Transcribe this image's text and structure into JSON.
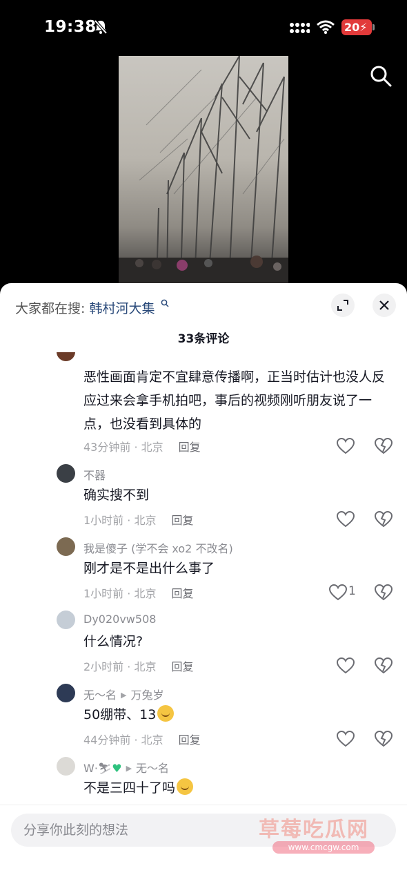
{
  "status_bar": {
    "time": "19:38",
    "battery": "20"
  },
  "search": {
    "prefix": "大家都在搜:",
    "term": "韩村河大集"
  },
  "comments_header": {
    "count_label": "33条评论"
  },
  "comments": [
    {
      "name": "",
      "text": "恶性画面肯定不宜肆意传播啊，正当时估计也没人反应过来会拿手机拍吧，事后的视频刚听朋友说了一点，也没看到具体的",
      "meta": "43分钟前 · 北京",
      "reply": "回复",
      "likes": ""
    },
    {
      "name": "不器",
      "text": "确实搜不到",
      "meta": "1小时前 · 北京",
      "reply": "回复",
      "likes": ""
    },
    {
      "name": "我是傻子 (学不会 xo2 不改名)",
      "text": "刚才是不是出什么事了",
      "meta": "1小时前 · 北京",
      "reply": "回复",
      "likes": "1"
    },
    {
      "name": "Dy020vw508",
      "text": "什么情况?",
      "meta": "2小时前 · 北京",
      "reply": "回复",
      "likes": ""
    },
    {
      "name": "无～名",
      "reply_to": "万兔岁",
      "text": "50绷带、13",
      "meta": "44分钟前 · 北京",
      "reply": "回复",
      "likes": ""
    },
    {
      "name": "W·",
      "reply_to": "无～名",
      "text": "不是三四十了吗",
      "meta": "",
      "reply": "",
      "likes": ""
    }
  ],
  "input": {
    "placeholder": "分享你此刻的想法"
  },
  "watermark": {
    "title": "草莓吃瓜网",
    "url": "www.cmcgw.com"
  },
  "colors": {
    "accent_link": "#2a4a7a",
    "battery_low": "#e23a3a",
    "emoji_heart": "#2ec27e"
  }
}
